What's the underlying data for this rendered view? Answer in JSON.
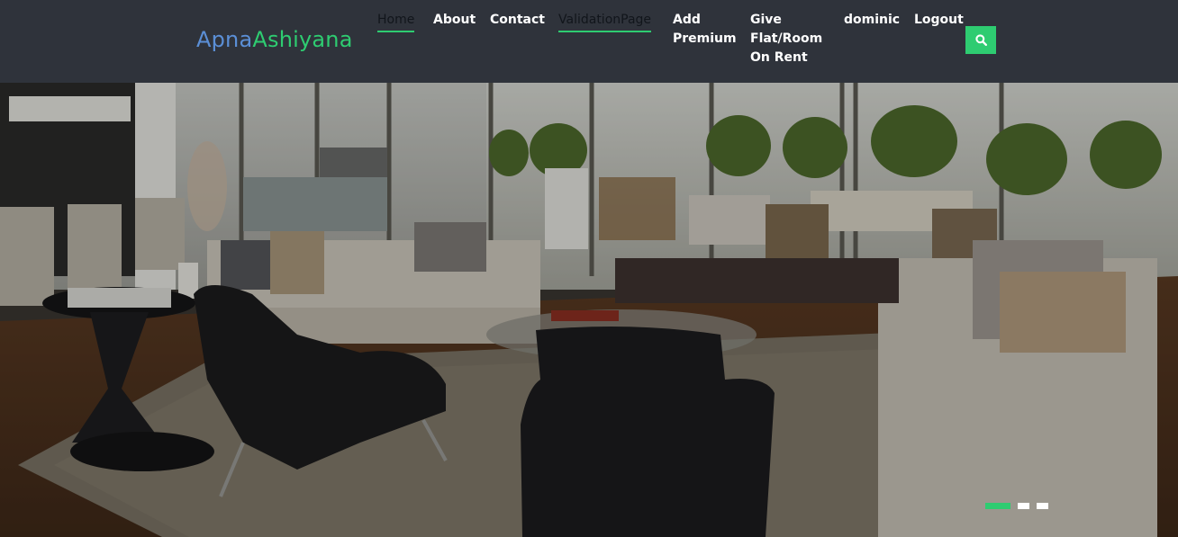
{
  "brand": {
    "part1": "Apna",
    "part2": "Ashiyana",
    "color1": "#5b8fd6",
    "color2": "#2ecc71"
  },
  "nav": {
    "home": "Home",
    "about": "About",
    "contact": "Contact",
    "validation": "ValidationPage",
    "add_premium": "Add Premium",
    "give_flat": "Give Flat/Room On Rent",
    "user": "dominic",
    "logout": "Logout"
  },
  "search": {
    "icon": "search-icon"
  },
  "hero": {
    "slide_count": 3,
    "active_slide": 1,
    "image": "living-room-photo"
  },
  "colors": {
    "navbar_bg": "#2f333b",
    "accent": "#2ecc71"
  }
}
